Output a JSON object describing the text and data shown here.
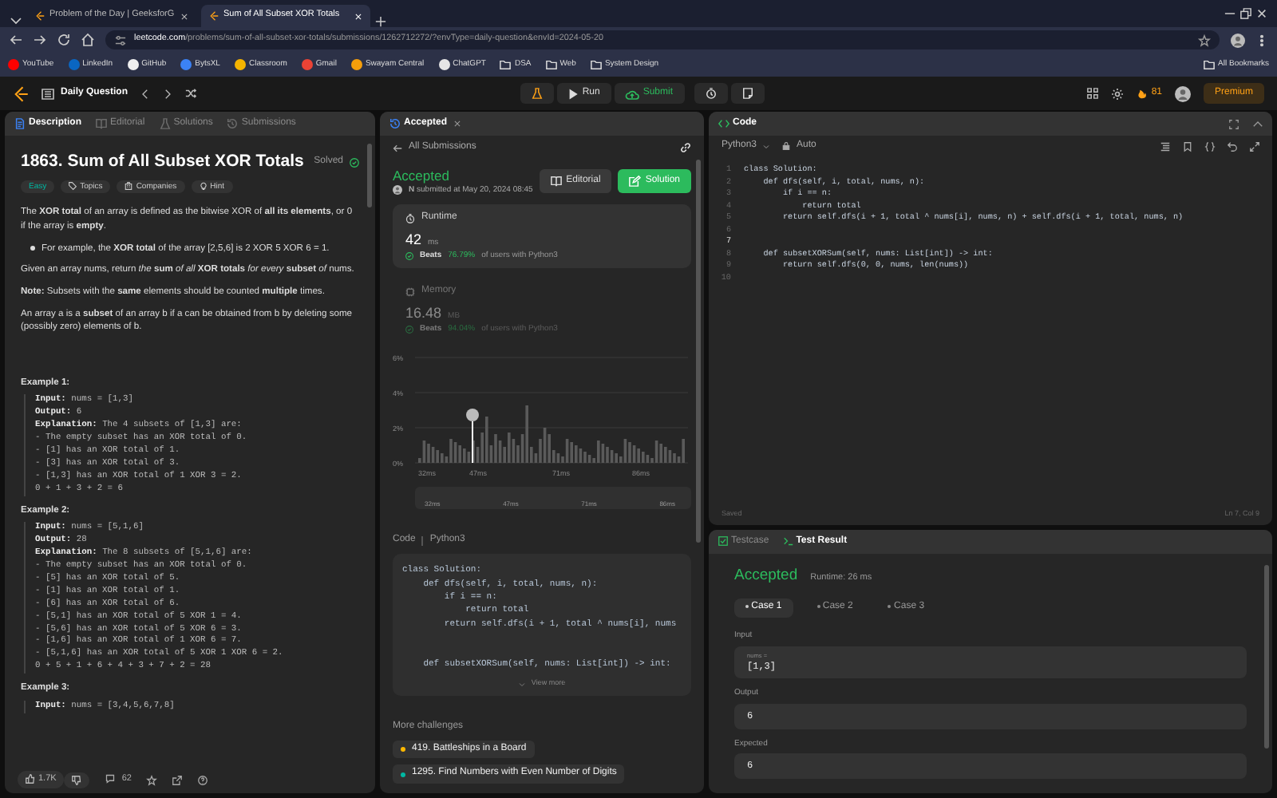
{
  "browser": {
    "tabs": [
      {
        "title": "Problem of the Day | GeeksforG",
        "selected": false
      },
      {
        "title": "Sum of All Subset XOR Totals",
        "selected": true
      }
    ],
    "url_host": "leetcode.com",
    "url_path": "/problems/sum-of-all-subset-xor-totals/submissions/1262712272/?envType=daily-question&envId=2024-05-20",
    "bookmarks": [
      {
        "label": "YouTube",
        "kind": "site",
        "color": "#ff0000"
      },
      {
        "label": "LinkedIn",
        "kind": "site",
        "color": "#0a66c2"
      },
      {
        "label": "GitHub",
        "kind": "site",
        "color": "#f0f0f0"
      },
      {
        "label": "BytsXL",
        "kind": "site",
        "color": "#3b82f6"
      },
      {
        "label": "Classroom",
        "kind": "site",
        "color": "#f4b400"
      },
      {
        "label": "Gmail",
        "kind": "site",
        "color": "#ea4335"
      },
      {
        "label": "Swayam Central",
        "kind": "site",
        "color": "#f59e0b"
      },
      {
        "label": "ChatGPT",
        "kind": "site",
        "color": "#e5e5e5"
      },
      {
        "label": "DSA",
        "kind": "folder"
      },
      {
        "label": "Web",
        "kind": "folder"
      },
      {
        "label": "System Design",
        "kind": "folder"
      }
    ],
    "all_bookmarks": "All Bookmarks"
  },
  "nav": {
    "title": "Daily Question",
    "run": "Run",
    "submit": "Submit",
    "streak": "81",
    "premium": "Premium"
  },
  "description": {
    "tabs": [
      {
        "label": "Description",
        "selected": true
      },
      {
        "label": "Editorial",
        "selected": false
      },
      {
        "label": "Solutions",
        "selected": false
      },
      {
        "label": "Submissions",
        "selected": false
      }
    ],
    "title": "1863. Sum of All Subset XOR Totals",
    "solved": "Solved",
    "tags": [
      {
        "label": "Easy",
        "kind": "difficulty"
      },
      {
        "label": "Topics",
        "kind": "topics"
      },
      {
        "label": "Companies",
        "kind": "companies"
      },
      {
        "label": "Hint",
        "kind": "hint"
      }
    ],
    "paragraphs": [
      {
        "kind": "text",
        "text": "The **XOR total** of an array is defined as the bitwise XOR of **all its elements**, or 0 if the array is **empty**."
      },
      {
        "kind": "bullet",
        "text": "For example, the **XOR total** of the array [2,5,6] is 2 XOR 5 XOR 6 = 1."
      },
      {
        "kind": "text",
        "text": "Given an array nums, return *the* **sum** *of all* **XOR totals** *for every* **subset** *of* nums."
      },
      {
        "kind": "text",
        "text": "**Note:** Subsets with the **same** elements should be counted **multiple** times."
      },
      {
        "kind": "text",
        "text": "An array a is a **subset** of an array b if a can be obtained from b by deleting some (possibly zero) elements of b."
      }
    ],
    "examples": [
      {
        "heading": "Example 1:",
        "lines": [
          "**Input:** nums = [1,3]",
          "**Output:** 6",
          "**Explanation:** The 4 subsets of [1,3] are:",
          "- The empty subset has an XOR total of 0.",
          "- [1] has an XOR total of 1.",
          "- [3] has an XOR total of 3.",
          "- [1,3] has an XOR total of 1 XOR 3 = 2.",
          "0 + 1 + 3 + 2 = 6"
        ]
      },
      {
        "heading": "Example 2:",
        "lines": [
          "**Input:** nums = [5,1,6]",
          "**Output:** 28",
          "**Explanation:** The 8 subsets of [5,1,6] are:",
          "- The empty subset has an XOR total of 0.",
          "- [5] has an XOR total of 5.",
          "- [1] has an XOR total of 1.",
          "- [6] has an XOR total of 6.",
          "- [5,1] has an XOR total of 5 XOR 1 = 4.",
          "- [5,6] has an XOR total of 5 XOR 6 = 3.",
          "- [1,6] has an XOR total of 1 XOR 6 = 7.",
          "- [5,1,6] has an XOR total of 5 XOR 1 XOR 6 = 2.",
          "0 + 5 + 1 + 6 + 4 + 3 + 7 + 2 = 28"
        ]
      },
      {
        "heading": "Example 3:",
        "lines": [
          "**Input:** nums = [3,4,5,6,7,8]"
        ]
      }
    ],
    "likes": "1.7K",
    "comments": "62"
  },
  "submission": {
    "tab": "Accepted",
    "back": "All Submissions",
    "status": "Accepted",
    "user_initial": "N",
    "submitted": "submitted at May 20, 2024 08:45",
    "editorial": "Editorial",
    "solution": "Solution",
    "metrics": [
      {
        "label": "Runtime",
        "value": "42",
        "unit": "ms",
        "beats": "Beats",
        "percent": "76.79%",
        "rest": "of users with Python3",
        "selected": true
      },
      {
        "label": "Memory",
        "value": "16.48",
        "unit": "MB",
        "beats": "Beats",
        "percent": "94.04%",
        "rest": "of users with Python3",
        "selected": false
      }
    ],
    "chart_yticks": [
      "6%",
      "4%",
      "2%",
      "0%"
    ],
    "chart_xticks": [
      "32ms",
      "47ms",
      "71ms",
      "86ms"
    ],
    "range_xticks": [
      "32ms",
      "47ms",
      "71ms",
      "86ms"
    ],
    "code_label": "Code",
    "code_language": "Python3",
    "code": [
      {
        "text": "class Solution:"
      },
      {
        "text": "    def dfs(self, i, total, nums, n):"
      },
      {
        "text": "        if i == n:"
      },
      {
        "text": "            return total"
      },
      {
        "text": "        return self.dfs(i + 1, total ^ nums[i], nums"
      },
      {
        "blank": true
      },
      {
        "blank": true
      },
      {
        "text": "    def subsetXORSum(self, nums: List[int]) -> int:"
      }
    ],
    "view_more": "View more",
    "more_title": "More challenges",
    "challenges": [
      {
        "label": "419. Battleships in a Board",
        "color": "#ffb800"
      },
      {
        "label": "1295. Find Numbers with Even Number of Digits",
        "color": "#00b8a3"
      }
    ]
  },
  "editor": {
    "title": "Code",
    "language": "Python3",
    "mode": "Auto",
    "lines": [
      {
        "no": "1",
        "code": "class Solution:",
        "current": false
      },
      {
        "no": "2",
        "code": "    def dfs(self, i, total, nums, n):",
        "current": false
      },
      {
        "no": "3",
        "code": "        if i == n:",
        "current": false
      },
      {
        "no": "4",
        "code": "            return total",
        "current": false
      },
      {
        "no": "5",
        "code": "        return self.dfs(i + 1, total ^ nums[i], nums, n) + self.dfs(i + 1, total, nums, n)",
        "current": false
      },
      {
        "no": "6",
        "current": false
      },
      {
        "no": "7",
        "current": true
      },
      {
        "no": "8",
        "code": "    def subsetXORSum(self, nums: List[int]) -> int:",
        "current": false
      },
      {
        "no": "9",
        "code": "        return self.dfs(0, 0, nums, len(nums))",
        "current": false
      },
      {
        "no": "10",
        "current": false
      }
    ],
    "status": "Saved",
    "position": "Ln 7, Col 9"
  },
  "result": {
    "tabs": [
      {
        "label": "Testcase",
        "selected": false
      },
      {
        "label": "Test Result",
        "selected": true
      }
    ],
    "verdict": "Accepted",
    "runtime": "Runtime: 26 ms",
    "cases": [
      {
        "label": "Case 1",
        "selected": true
      },
      {
        "label": "Case 2",
        "selected": false
      },
      {
        "label": "Case 3",
        "selected": false
      }
    ],
    "input_label": "Input",
    "param": "nums =",
    "input": "[1,3]",
    "output_label": "Output",
    "output": "6",
    "expected_label": "Expected",
    "expected": "6"
  }
}
